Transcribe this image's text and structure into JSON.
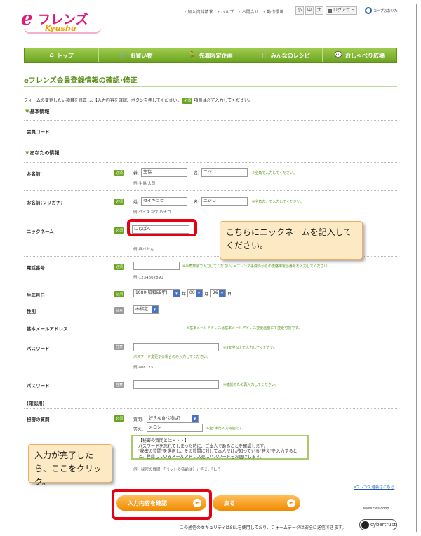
{
  "header": {
    "logo_e": "e",
    "logo_main": "フレンズ",
    "logo_sub": "Kyushu",
    "links": [
      "加入資料請求",
      "ヘルプ",
      "お問合せ",
      "動作環境"
    ],
    "font_sizes": [
      "小",
      "中",
      "大"
    ],
    "logout": "ログアウト",
    "coop": "コープおおいた"
  },
  "nav": [
    {
      "icon": "⌂",
      "icon_name": "home-icon",
      "label": "トップ"
    },
    {
      "icon": "🛒",
      "icon_name": "cart-icon",
      "label": "お買い物"
    },
    {
      "icon": "🏃",
      "icon_name": "runner-icon",
      "label": "先着限定企画"
    },
    {
      "icon": "🍴",
      "icon_name": "fork-knife-icon",
      "label": "みんなのレシピ"
    },
    {
      "icon": "💬",
      "icon_name": "chat-bubble-icon",
      "label": "おしゃべり広場"
    }
  ],
  "page": {
    "title": "eフレンズ会員登録情報の確認･修正",
    "intro_before": "フォームの変更したい項目を修正し、【入力内容を確認】ボタンを押してください。",
    "intro_after": "項目は必ず入力してください。",
    "required": "必須",
    "optional": "任意"
  },
  "sections": {
    "basic": "基本情報",
    "yours": "あなたの情報"
  },
  "fields": {
    "member_code": "会員コード",
    "name": {
      "label": "お名前",
      "sei_label": "姓:",
      "sei": "生協",
      "mei_label": "名:",
      "mei": "ニジコ",
      "hint": "※全角で入力してください。",
      "example": "例)生協 太郎"
    },
    "kana": {
      "label": "お名前(フリガナ)",
      "sei_label": "姓:",
      "sei": "セイキョウ",
      "mei_label": "名:",
      "mei": "ニジコ",
      "hint": "※全角カナで入力してください。",
      "example": "例)セイキョウ ハナコ"
    },
    "nickname": {
      "label": "ニックネーム",
      "value": "にじぱん",
      "example": "例)ほぺたん"
    },
    "phone": {
      "label": "電話番号",
      "value": "",
      "hint": "※半角数字で入力してください。eフレンズ事務局からの連絡用電話番号を入力してください。",
      "example": "例)1234567890"
    },
    "birthday": {
      "label": "生年月日",
      "year": "1980(昭和55年)",
      "year_unit": "年",
      "month": "09",
      "month_unit": "月",
      "day": "26",
      "day_unit": "日"
    },
    "gender": {
      "label": "性別",
      "value": "未指定"
    },
    "email": {
      "label": "基本メールアドレス",
      "hint": "※基本メールアドレスは基本メールアドレス変更画面にて変更可能です。"
    },
    "password": {
      "label": "パスワード",
      "hint": "※3文字以上で入力してください。",
      "note": "パスワード変更する場合のみ入力してください。",
      "example": "例)abc123"
    },
    "password_confirm": {
      "label": "パスワード",
      "label2": "(確認用)",
      "hint": "※確認のため再入力してください。"
    },
    "secret": {
      "label": "秘密の質問",
      "q_label": "質問:",
      "q_value": "好きな食べ物は？",
      "a_label": "答え:",
      "a_value": "メロン",
      "hint": "※全･半角入力可能です。",
      "box_title": "【秘密の質問とは・・・】",
      "box_lines": [
        "パスワードを忘れてしまった時に、ご本人であることを確認します。",
        "\"秘密の質問\"を選択し、その質問に対して本人だけが知っている\"答え\"を入力すると",
        "と、登録しているメールアドレス宛にパスワードをお届けします。"
      ],
      "example": "例）秘密の質問:「ペットの名前は？」答え:「しろ」"
    }
  },
  "callouts": {
    "nickname": "こちらにニックネームを記入してください。",
    "submit": "入力が完了したら、ここをクリック。"
  },
  "links": {
    "efriends": "eフレンズ退会はこちら"
  },
  "buttons": {
    "confirm": "入力内容を確認",
    "back": "戻る"
  },
  "footer": {
    "cws": "www.cws.coop",
    "security": "この通信のセキュリティはSSLを使用しており、フォームデータは安全に送信できます。",
    "cybertrust": "cybertrust"
  }
}
